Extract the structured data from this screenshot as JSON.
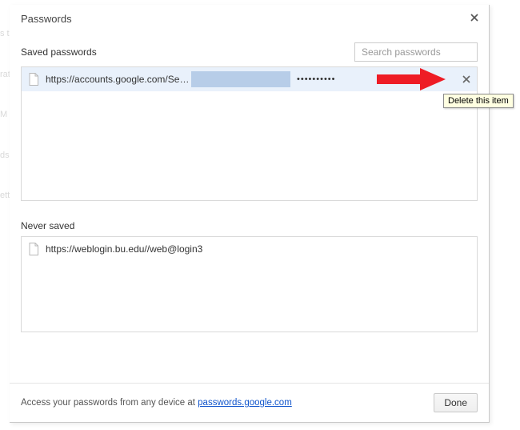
{
  "dialog": {
    "title": "Passwords",
    "close_aria": "Close"
  },
  "saved": {
    "label": "Saved passwords",
    "search_placeholder": "Search passwords",
    "entries": [
      {
        "site": "https://accounts.google.com/Servic…",
        "password_mask": "••••••••••",
        "delete_tooltip": "Delete this item"
      }
    ]
  },
  "never": {
    "label": "Never saved",
    "entries": [
      {
        "site": "https://weblogin.bu.edu//web@login3"
      }
    ]
  },
  "footer": {
    "text_prefix": "Access your passwords from any device at ",
    "link_text": "passwords.google.com",
    "done_label": "Done"
  }
}
